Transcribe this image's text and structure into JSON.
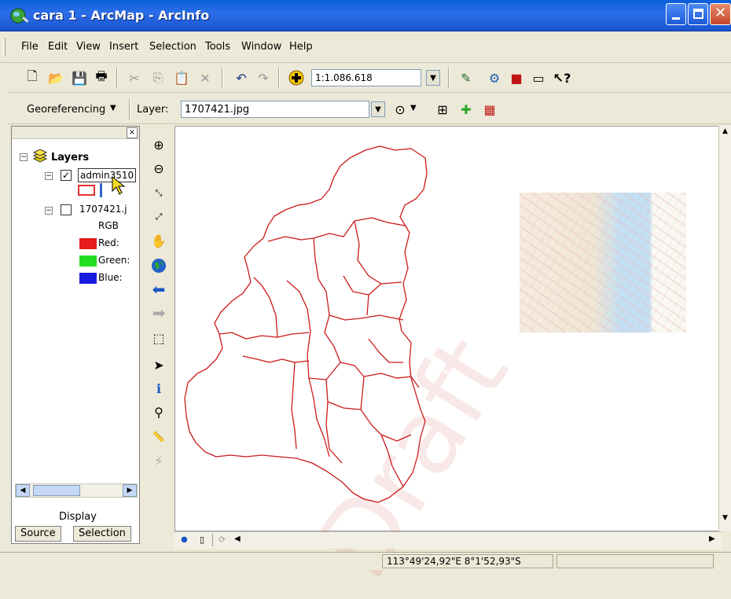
{
  "window": {
    "title": "cara 1 - ArcMap - ArcInfo"
  },
  "menu": [
    "File",
    "Edit",
    "View",
    "Insert",
    "Selection",
    "Tools",
    "Window",
    "Help"
  ],
  "toolbar": {
    "scale": "1:1.086.618"
  },
  "georef": {
    "label": "Georeferencing",
    "layer_label": "Layer:",
    "layer_value": "1707421.jpg"
  },
  "toc": {
    "root": "Layers",
    "layer1": "admin3510",
    "layer2": "1707421.j",
    "rgb": "RGB",
    "bands": [
      {
        "label": "Red:",
        "color": "#E81B1B"
      },
      {
        "label": "Green:",
        "color": "#22DD22"
      },
      {
        "label": "Blue:",
        "color": "#1A1AE0"
      }
    ],
    "display_label": "Display",
    "tabs": [
      "Source",
      "Selection"
    ]
  },
  "map": {
    "watermark": "Draft",
    "polygon_color": "#CC1A1A"
  },
  "status": {
    "coords": "113°49'24,92\"E  8°1'52,93\"S"
  }
}
